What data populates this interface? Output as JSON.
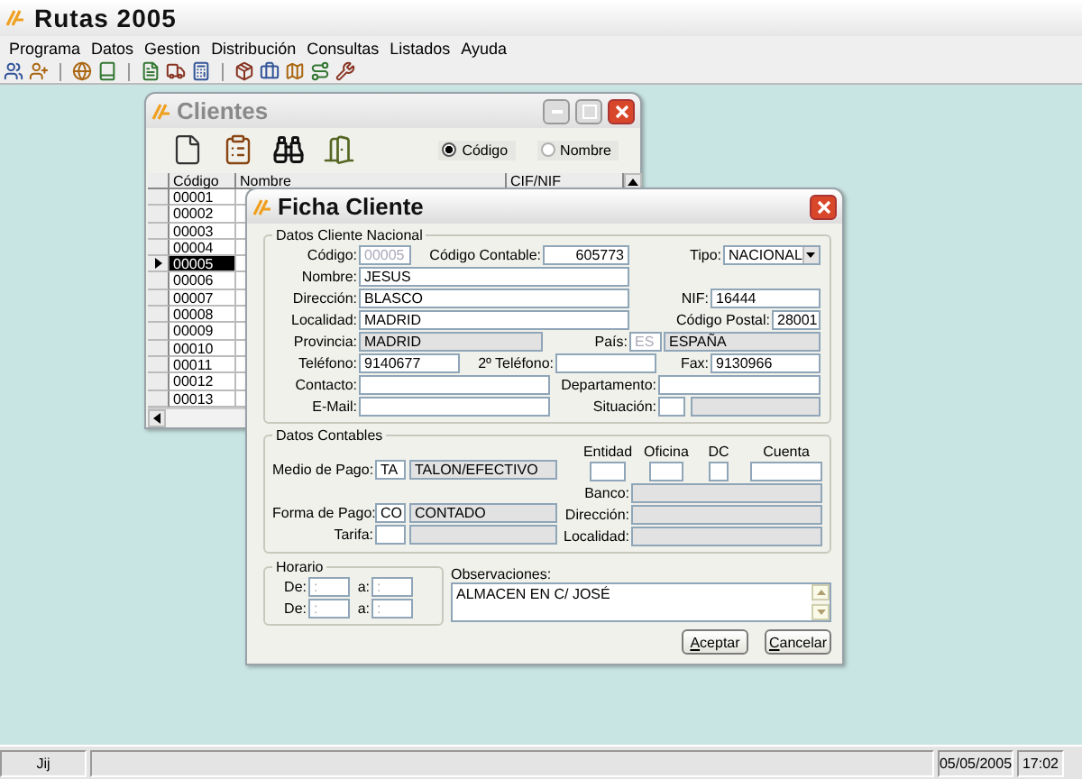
{
  "app": {
    "title": "Rutas 2005"
  },
  "menu": [
    "Programa",
    "Datos",
    "Gestion",
    "Distribución",
    "Consultas",
    "Listados",
    "Ayuda"
  ],
  "clientes": {
    "title": "Clientes",
    "search_by": [
      {
        "label": "Código",
        "selected": true
      },
      {
        "label": "Nombre",
        "selected": false
      }
    ],
    "columns": [
      "Código",
      "Nombre",
      "CIF/NIF"
    ],
    "rows": [
      {
        "codigo": "00001",
        "selected": false
      },
      {
        "codigo": "00002",
        "selected": false
      },
      {
        "codigo": "00003",
        "selected": false
      },
      {
        "codigo": "00004",
        "selected": false
      },
      {
        "codigo": "00005",
        "selected": true
      },
      {
        "codigo": "00006",
        "selected": false
      },
      {
        "codigo": "00007",
        "selected": false
      },
      {
        "codigo": "00008",
        "selected": false
      },
      {
        "codigo": "00009",
        "selected": false
      },
      {
        "codigo": "00010",
        "selected": false
      },
      {
        "codigo": "00011",
        "selected": false
      },
      {
        "codigo": "00012",
        "selected": false
      },
      {
        "codigo": "00013",
        "selected": false
      }
    ]
  },
  "ficha": {
    "title": "Ficha Cliente",
    "cliente": {
      "legend": "Datos Cliente Nacional",
      "codigo": {
        "label": "Código:",
        "value": "00005",
        "readonly": false,
        "disabled": true
      },
      "codigo_contable": {
        "label": "Código Contable:",
        "value": "605773",
        "readonly": false
      },
      "tipo": {
        "label": "Tipo:",
        "value": "NACIONAL"
      },
      "nombre": {
        "label": "Nombre:",
        "value": "JESUS",
        "readonly": false
      },
      "direccion": {
        "label": "Dirección:",
        "value": "BLASCO",
        "readonly": false
      },
      "nif": {
        "label": "NIF:",
        "value": "16444",
        "readonly": false
      },
      "localidad": {
        "label": "Localidad:",
        "value": "MADRID",
        "readonly": false
      },
      "codigo_postal": {
        "label": "Código Postal:",
        "value": "28001",
        "readonly": false
      },
      "provincia": {
        "label": "Provincia:",
        "value": "MADRID",
        "readonly": true
      },
      "pais": {
        "label": "País:",
        "code": {
          "value": "ES",
          "readonly": false,
          "disabled": true
        },
        "name": {
          "value": "ESPAÑA",
          "readonly": true
        }
      },
      "telefono": {
        "label": "Teléfono:",
        "value": "9140677",
        "readonly": false
      },
      "telefono2": {
        "label": "2º Teléfono:",
        "readonly": false
      },
      "fax": {
        "label": "Fax:",
        "value": "9130966",
        "readonly": false
      },
      "contacto": {
        "label": "Contacto:",
        "readonly": false
      },
      "departamento": {
        "label": "Departamento:",
        "readonly": false
      },
      "email": {
        "label": "E-Mail:",
        "readonly": false
      },
      "situacion": {
        "label": "Situación:",
        "code": {
          "readonly": false
        },
        "name": {
          "readonly": true
        }
      }
    },
    "contables": {
      "legend": "Datos Contables",
      "medio_pago": {
        "label": "Medio de Pago:",
        "code": {
          "value": "TA",
          "readonly": false
        },
        "description": {
          "value": "TALON/EFECTIVO",
          "readonly": true
        }
      },
      "forma_pago": {
        "label": "Forma de Pago:",
        "code": {
          "value": "CO",
          "readonly": false
        },
        "description": {
          "value": "CONTADO",
          "readonly": true
        }
      },
      "tarifa": {
        "label": "Tarifa:",
        "code": {
          "readonly": false
        },
        "description": {
          "readonly": true
        }
      },
      "cuenta_bancaria": [
        {
          "label": "Entidad",
          "readonly": false
        },
        {
          "label": "Oficina",
          "readonly": false
        },
        {
          "label": "DC",
          "readonly": false
        },
        {
          "label": "Cuenta",
          "readonly": false
        }
      ],
      "banco": {
        "label": "Banco:",
        "readonly": true
      },
      "direccion": {
        "label": "Dirección:",
        "readonly": true
      },
      "localidad": {
        "label": "Localidad:",
        "readonly": true
      }
    },
    "horario": {
      "legend": "Horario",
      "rows": [
        {
          "from_label": "De:",
          "from": ":",
          "to_label": "a:",
          "to": ":"
        },
        {
          "from_label": "De:",
          "from": ":",
          "to_label": "a:",
          "to": ":"
        }
      ]
    },
    "observaciones": {
      "label": "Observaciones:",
      "value": "ALMACEN EN C/ JOSÉ"
    },
    "buttons": [
      "Aceptar",
      "Cancelar"
    ]
  },
  "status_bar": {
    "user": "Jij",
    "date": "05/05/2005",
    "time": "17:02"
  }
}
